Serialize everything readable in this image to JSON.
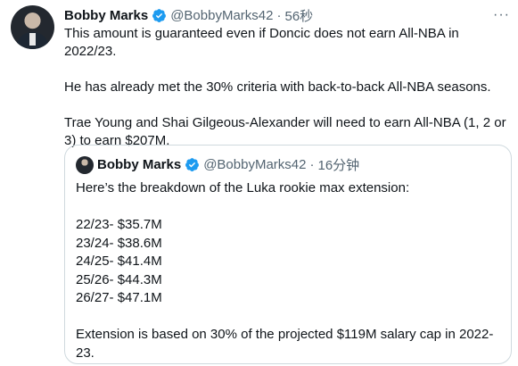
{
  "tweet": {
    "author_name": "Bobby Marks",
    "author_handle": "@BobbyMarks42",
    "time": "56秒",
    "paragraphs": [
      "This amount is guaranteed even if Doncic does not earn All-NBA in 2022/23.",
      "He has already met the 30% criteria with back-to-back All-NBA seasons.",
      "Trae Young and Shai Gilgeous-Alexander will need to earn All-NBA (1, 2 or 3) to earn $207M."
    ]
  },
  "quoted_tweet": {
    "author_name": "Bobby Marks",
    "author_handle": "@BobbyMarks42",
    "time": "16分钟",
    "intro": "Here’s the breakdown of the Luka rookie max extension:",
    "lines": [
      "22/23- $35.7M",
      "23/24- $38.6M",
      "24/25- $41.4M",
      "25/26- $44.3M",
      "26/27- $47.1M"
    ],
    "footer": "Extension is based on 30% of the projected $119M salary cap in 2022-23."
  },
  "icons": {
    "verified": "verified-badge-icon",
    "more": "more-options-icon"
  },
  "colors": {
    "verified": "#1d9bf0",
    "secondary_text": "#536471",
    "border": "#cfd9de"
  }
}
